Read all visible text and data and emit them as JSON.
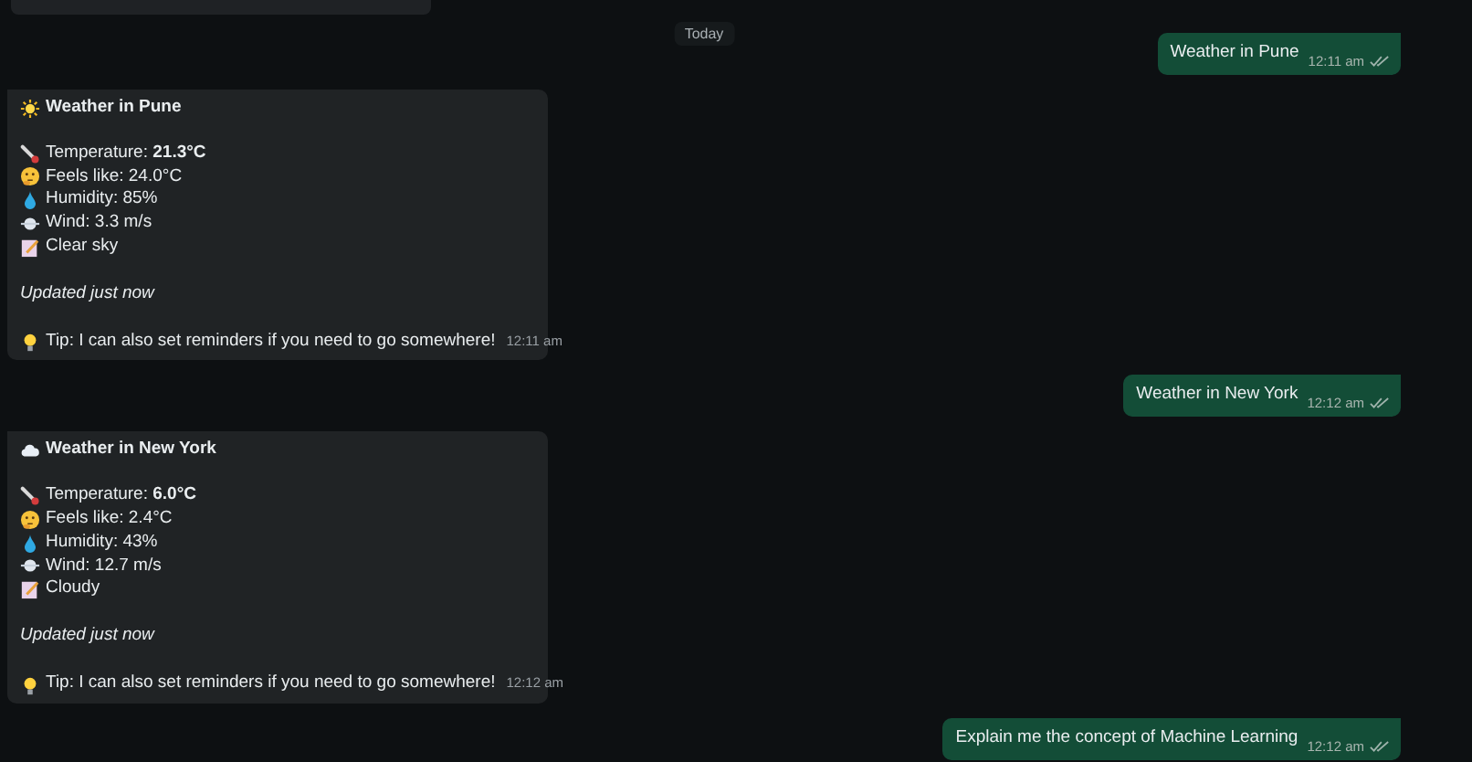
{
  "date_chip": "Today",
  "messages": [
    {
      "kind": "outgoing",
      "text": "Weather in Pune",
      "time": "12:11 am"
    },
    {
      "kind": "incoming",
      "title": {
        "kind": "sun",
        "text": "Weather in Pune"
      },
      "lines": [
        {
          "kind": "thermometer",
          "text": "Temperature: **21.3°C**"
        },
        {
          "kind": "thinking",
          "text": "Feels like: 24.0°C"
        },
        {
          "kind": "droplet",
          "text": "Humidity: 85%"
        },
        {
          "kind": "wind",
          "text": "Wind: 3.3 m/s"
        },
        {
          "kind": "memo",
          "text": "Clear sky"
        }
      ],
      "updated": "Updated just now",
      "tip": "Tip: I can also set reminders if you need to go somewhere!",
      "time": "12:11 am"
    },
    {
      "kind": "outgoing",
      "text": "Weather in New York",
      "time": "12:12 am"
    },
    {
      "kind": "incoming",
      "title": {
        "kind": "cloud",
        "text": "Weather in New York"
      },
      "lines": [
        {
          "kind": "thermometer",
          "text": "Temperature: **6.0°C**"
        },
        {
          "kind": "thinking",
          "text": "Feels like: 2.4°C"
        },
        {
          "kind": "droplet",
          "text": "Humidity: 43%"
        },
        {
          "kind": "wind",
          "text": "Wind: 12.7 m/s"
        },
        {
          "kind": "memo",
          "text": "Cloudy"
        }
      ],
      "updated": "Updated just now",
      "tip": "Tip: I can also set reminders if you need to go somewhere!",
      "time": "12:12 am"
    },
    {
      "kind": "outgoing",
      "text": "Explain me the concept of Machine Learning",
      "time": "12:12 am"
    }
  ]
}
